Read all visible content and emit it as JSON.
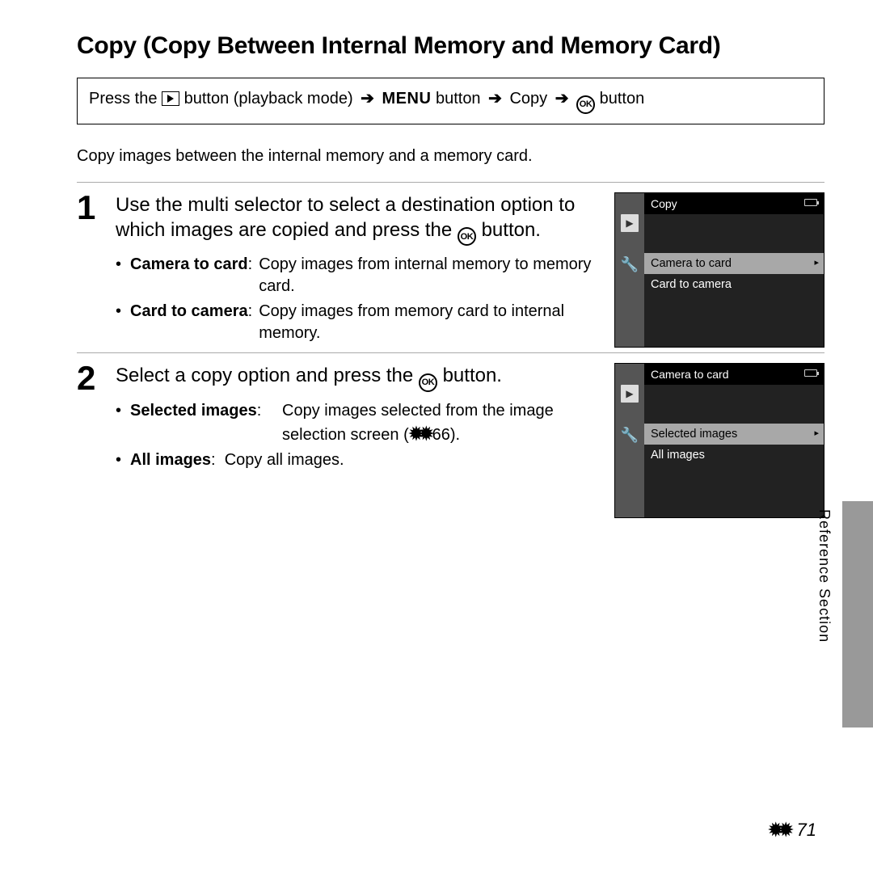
{
  "title": "Copy (Copy Between Internal Memory and Memory Card)",
  "path": {
    "prefix": "Press the ",
    "seg2": " button (playback mode) ",
    "menu": "MENU",
    "seg3": " button ",
    "copy": " Copy ",
    "suffix": " button"
  },
  "intro": "Copy images between the internal memory and a memory card.",
  "step1": {
    "num": "1",
    "head_a": "Use the multi selector to select a destination option to which images are copied and press the ",
    "head_b": " button.",
    "b1_term": "Camera to card",
    "b1_desc": "Copy images from internal memory to memory card.",
    "b2_term": "Card to camera",
    "b2_desc": "Copy images from memory card to internal memory.",
    "cam_title": "Copy",
    "cam_opt1": "Camera to card",
    "cam_opt2": "Card to camera"
  },
  "step2": {
    "num": "2",
    "head_a": "Select a copy option and press the ",
    "head_b": " button.",
    "b1_term": "Selected images",
    "b1_desc_a": "Copy images selected from the image selection screen (",
    "b1_desc_ref": "66",
    "b1_desc_b": ").",
    "b2_term": "All images",
    "b2_desc": "Copy all images.",
    "cam_title": "Camera to card",
    "cam_opt1": "Selected images",
    "cam_opt2": "All images"
  },
  "side_label": "Reference Section",
  "page_number": "71"
}
